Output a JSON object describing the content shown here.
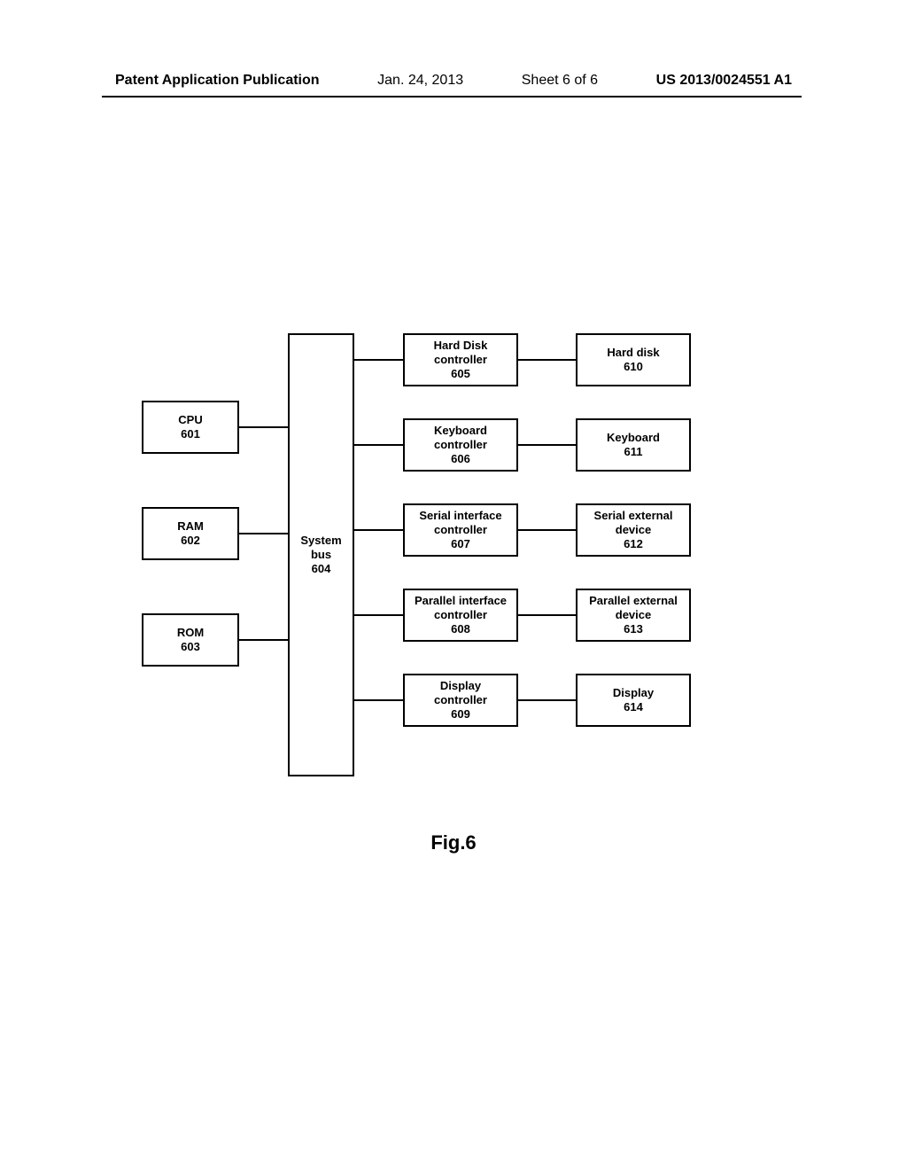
{
  "header": {
    "publication": "Patent Application Publication",
    "date": "Jan. 24, 2013",
    "sheet": "Sheet 6 of 6",
    "docnum": "US 2013/0024551 A1"
  },
  "figure_label": "Fig.6",
  "blocks": {
    "cpu": {
      "l1": "CPU",
      "l2": "601"
    },
    "ram": {
      "l1": "RAM",
      "l2": "602"
    },
    "rom": {
      "l1": "ROM",
      "l2": "603"
    },
    "bus": {
      "l1": "System",
      "l2": "bus",
      "l3": "604"
    },
    "hdc": {
      "l1": "Hard Disk",
      "l2": "controller",
      "l3": "605"
    },
    "kbc": {
      "l1": "Keyboard",
      "l2": "controller",
      "l3": "606"
    },
    "sic": {
      "l1": "Serial interface",
      "l2": "controller",
      "l3": "607"
    },
    "pic": {
      "l1": "Parallel interface",
      "l2": "controller",
      "l3": "608"
    },
    "dc": {
      "l1": "Display",
      "l2": "controller",
      "l3": "609"
    },
    "hd": {
      "l1": "Hard disk",
      "l2": "610"
    },
    "kb": {
      "l1": "Keyboard",
      "l2": "611"
    },
    "sed": {
      "l1": "Serial external",
      "l2": "device",
      "l3": "612"
    },
    "ped": {
      "l1": "Parallel external",
      "l2": "device",
      "l3": "613"
    },
    "disp": {
      "l1": "Display",
      "l2": "614"
    }
  }
}
